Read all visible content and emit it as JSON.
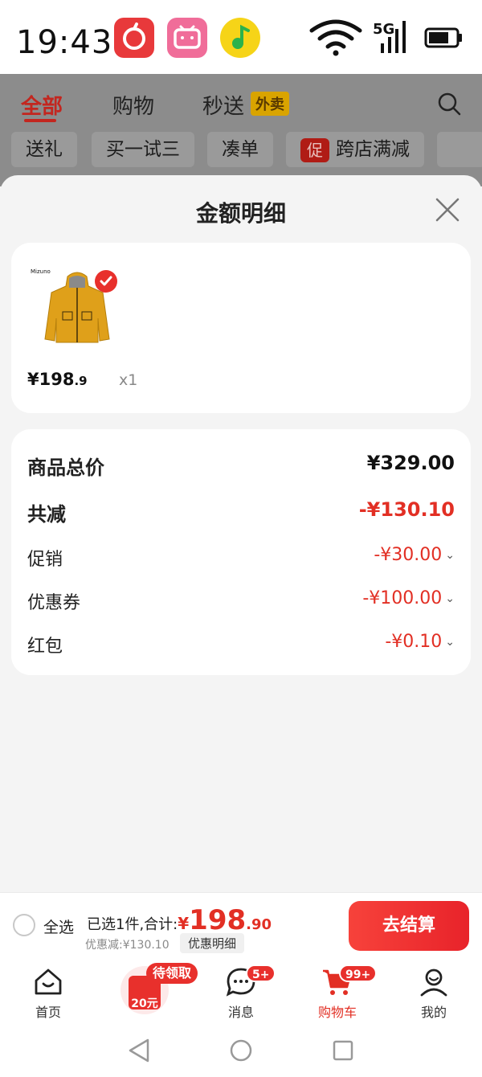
{
  "status_bar": {
    "time": "19:43",
    "network": "5G"
  },
  "background_page": {
    "tabs": [
      {
        "label": "全部"
      },
      {
        "label": "购物"
      },
      {
        "label": "秒送"
      }
    ],
    "takeaway_badge": "外卖",
    "chips": [
      {
        "label": "送礼"
      },
      {
        "label": "买一试三"
      },
      {
        "label": "凑单"
      },
      {
        "label": "跨店满减",
        "icon_text": "促"
      }
    ]
  },
  "sheet": {
    "title": "金额明细",
    "product": {
      "price_main": "¥198",
      "price_decimal": ".9",
      "quantity": "x1",
      "brand": "Mizuno"
    },
    "summary": {
      "total_label": "商品总价",
      "total_value": "¥329.00",
      "reduce_label": "共减",
      "reduce_value": "-¥130.10",
      "items": [
        {
          "label": "促销",
          "value": "-¥30.00"
        },
        {
          "label": "优惠券",
          "value": "-¥100.00"
        },
        {
          "label": "红包",
          "value": "-¥0.10"
        }
      ]
    }
  },
  "checkout": {
    "select_all": "全选",
    "selected_text": "已选1件,合计:",
    "currency": "¥",
    "amount_int": "198",
    "amount_dec": ".90",
    "discount_text": "优惠减:¥130.10",
    "detail_button": "优惠明细",
    "pay_button": "去结算"
  },
  "bottom_nav": {
    "items": [
      {
        "label": "首页"
      },
      {
        "label": ""
      },
      {
        "label": "消息",
        "badge": "5+"
      },
      {
        "label": "购物车",
        "badge": "99+"
      },
      {
        "label": "我的"
      }
    ],
    "promo_badge": "待领取",
    "promo_amount": "20元"
  },
  "colors": {
    "accent": "#e22f24",
    "background": "#f4f4f4",
    "dim_overlay": "#8c8c8c"
  }
}
